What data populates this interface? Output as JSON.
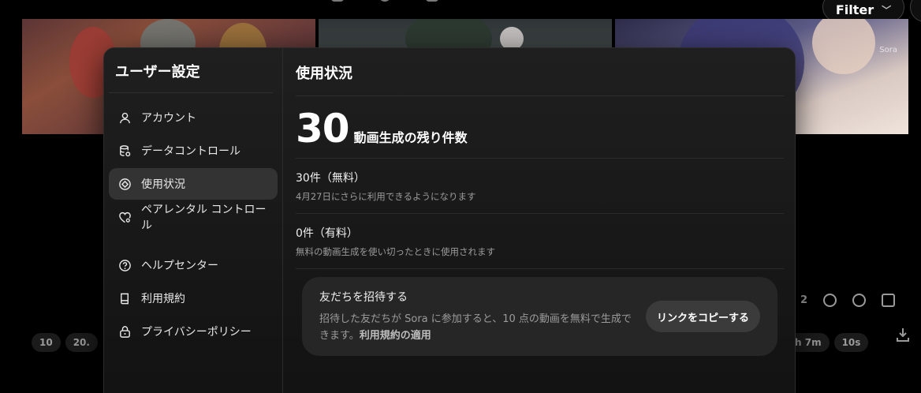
{
  "background": {
    "filter_button": {
      "label": "Filter"
    },
    "bottom_pills": [
      "10",
      "20."
    ],
    "right_pills": [
      "h 7m",
      "10s"
    ],
    "action_count": "2",
    "thumbnail_watermark": "Sora"
  },
  "modal": {
    "sidebar": {
      "title": "ユーザー設定",
      "items": [
        {
          "label": "アカウント",
          "icon": "person-icon"
        },
        {
          "label": "データコントロール",
          "icon": "database-icon"
        },
        {
          "label": "使用状況",
          "icon": "usage-icon",
          "active": true
        },
        {
          "label": "ペアレンタル コントロール",
          "icon": "heart-icon"
        }
      ],
      "secondary_items": [
        {
          "label": "ヘルプセンター",
          "icon": "help-icon"
        },
        {
          "label": "利用規約",
          "icon": "book-icon"
        },
        {
          "label": "プライバシーポリシー",
          "icon": "lock-icon"
        }
      ]
    },
    "main": {
      "title": "使用状況",
      "remaining": {
        "count": "30",
        "label": "動画生成の残り件数"
      },
      "quotas": [
        {
          "title": "30件（無料）",
          "description": "4月27日にさらに利用できるようになります"
        },
        {
          "title": "0件（有料）",
          "description": "無料の動画生成を使い切ったときに使用されます"
        }
      ],
      "invite": {
        "title": "友だちを招待する",
        "description": "招待した友だちが Sora に参加すると、10 点の動画を無料で生成できます。",
        "link_text": "利用規約の適用",
        "button_label": "リンクをコピーする"
      }
    }
  }
}
